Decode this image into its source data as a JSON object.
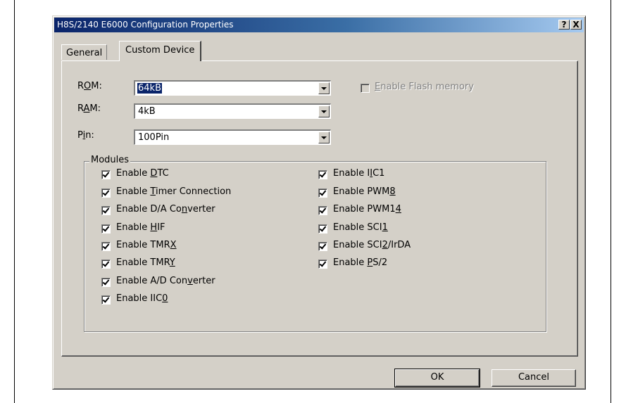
{
  "window": {
    "title": "H8S/2140 E6000 Configuration Properties",
    "help_button": "?",
    "close_button": "X"
  },
  "tabs": [
    {
      "label": "General",
      "selected": false
    },
    {
      "label": "Custom Device",
      "selected": true
    }
  ],
  "fields": {
    "rom": {
      "label_pre": "R",
      "label_key": "O",
      "label_post": "M:",
      "value": "64kB"
    },
    "ram": {
      "label_pre": "R",
      "label_key": "A",
      "label_post": "M:",
      "value": "4kB"
    },
    "pin": {
      "label_pre": "P",
      "label_key": "i",
      "label_post": "n:",
      "value": "100Pin"
    }
  },
  "flash": {
    "label_pre": "",
    "label_key": "E",
    "label_post": "nable Flash memory",
    "checked": false,
    "enabled": false
  },
  "modules": {
    "label": "Modules",
    "left": [
      {
        "pre": "Enable ",
        "key": "D",
        "post": "TC",
        "checked": true
      },
      {
        "pre": "Enable ",
        "key": "T",
        "post": "imer Connection",
        "checked": true
      },
      {
        "pre": "Enable D/A Co",
        "key": "n",
        "post": "verter",
        "checked": true
      },
      {
        "pre": "Enable ",
        "key": "H",
        "post": "IF",
        "checked": true
      },
      {
        "pre": "Enable TMR",
        "key": "X",
        "post": "",
        "checked": true
      },
      {
        "pre": "Enable TMR",
        "key": "Y",
        "post": "",
        "checked": true
      },
      {
        "pre": "Enable A/D Con",
        "key": "v",
        "post": "erter",
        "checked": true
      },
      {
        "pre": "Enable IIC",
        "key": "0",
        "post": "",
        "checked": true
      }
    ],
    "right": [
      {
        "pre": "Enable I",
        "key": "I",
        "post": "C1",
        "checked": true
      },
      {
        "pre": "Enable PWM",
        "key": "8",
        "post": "",
        "checked": true
      },
      {
        "pre": "Enable PWM1",
        "key": "4",
        "post": "",
        "checked": true
      },
      {
        "pre": "Enable SCI",
        "key": "1",
        "post": "",
        "checked": true
      },
      {
        "pre": "Enable SCI",
        "key": "2",
        "post": "/IrDA",
        "checked": true
      },
      {
        "pre": "Enable ",
        "key": "P",
        "post": "S/2",
        "checked": true
      }
    ]
  },
  "buttons": {
    "ok": "OK",
    "cancel": "Cancel"
  }
}
